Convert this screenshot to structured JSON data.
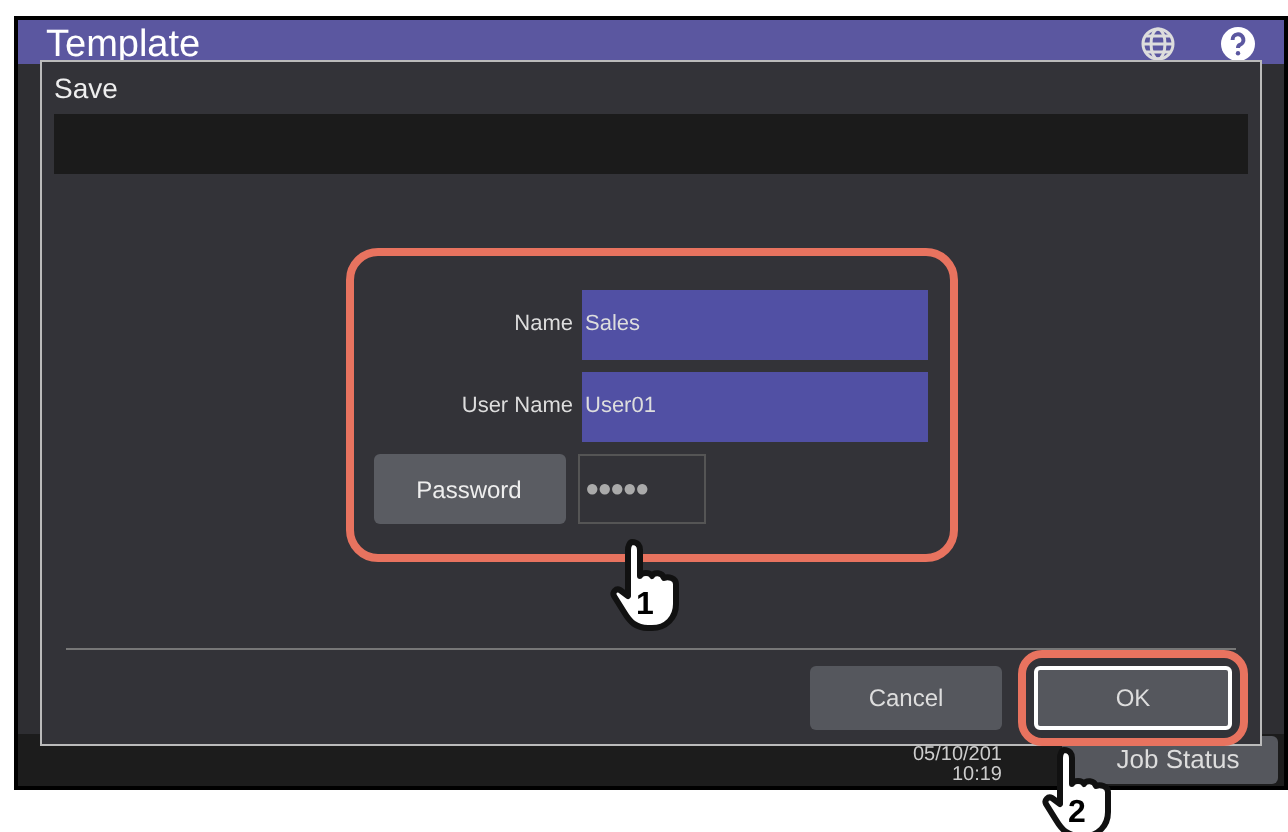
{
  "screen": {
    "title": "Template",
    "date": "05/10/201",
    "time": "10:19",
    "job_status_button": "Job Status"
  },
  "dialog": {
    "title": "Save",
    "fields": [
      {
        "label": "Name",
        "value": "Sales"
      },
      {
        "label": "User Name",
        "value": "User01"
      }
    ],
    "password": {
      "button": "Password",
      "value": "●●●●●"
    },
    "buttons": [
      {
        "label": "Cancel",
        "highlighted": false
      },
      {
        "label": "OK",
        "highlighted": true
      }
    ]
  },
  "callouts": [
    "1",
    "2"
  ]
}
